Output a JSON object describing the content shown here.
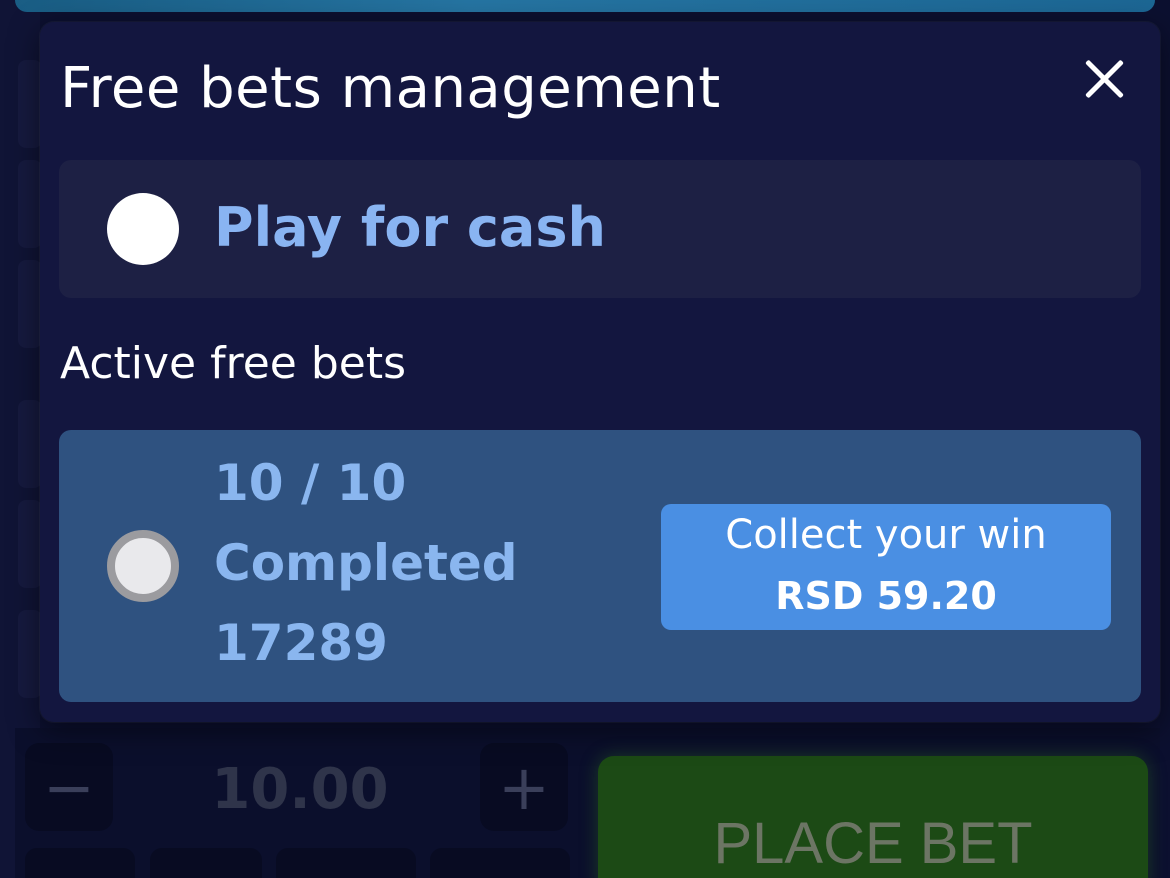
{
  "modal": {
    "title": "Free bets management",
    "play_for_cash_label": "Play for cash",
    "section_title": "Active free bets",
    "free_bet": {
      "progress": "10 / 10",
      "status": "Completed",
      "id": "17289",
      "collect_label": "Collect your win",
      "collect_amount": "RSD 59.20"
    }
  },
  "background": {
    "bet_amount": "10.00",
    "minus_label": "−",
    "plus_label": "+",
    "place_bet_label": "PLACE BET"
  },
  "colors": {
    "accent_blue": "#4a8fe3",
    "label_blue": "#89b4f2",
    "card_bg": "#2f5280",
    "modal_bg": "#13163f",
    "place_bet_green": "#1c4a15"
  }
}
